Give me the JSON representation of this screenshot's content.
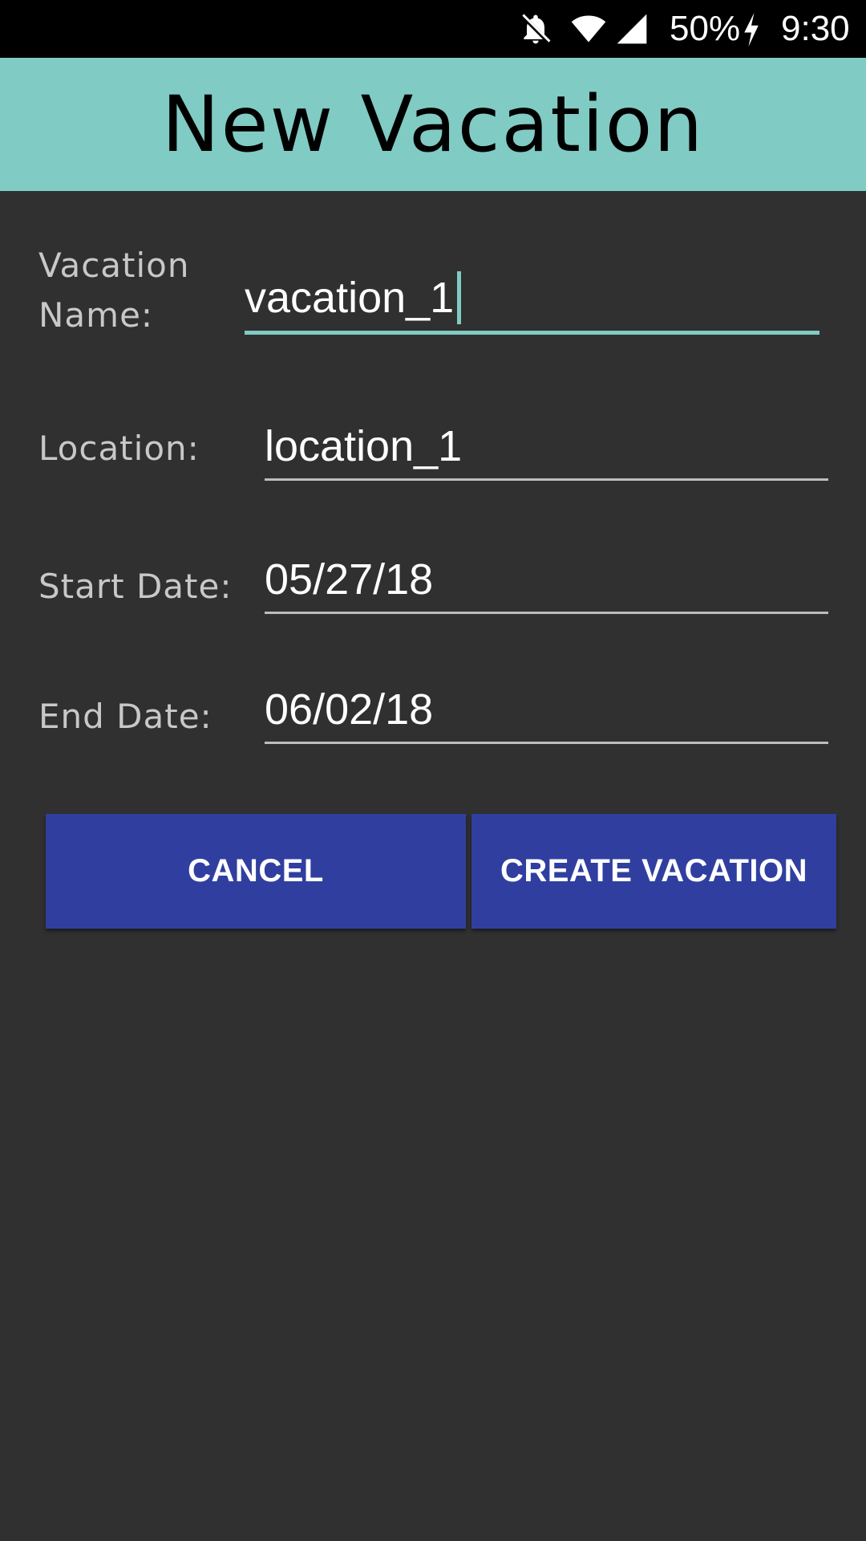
{
  "status_bar": {
    "battery": "50%",
    "time": "9:30",
    "icons": [
      "notifications-off-icon",
      "wifi-icon",
      "cell-signal-icon",
      "charging-bolt-icon"
    ]
  },
  "app_bar": {
    "title": "New Vacation",
    "background_color": "#80cbc4"
  },
  "form": {
    "vacation_name": {
      "label_line1": "Vacation",
      "label_line2": "Name:",
      "value": "vacation_1"
    },
    "location": {
      "label": "Location:",
      "value": "location_1"
    },
    "start_date": {
      "label": "Start Date:",
      "value": "05/27/18"
    },
    "end_date": {
      "label": "End Date:",
      "value": "06/02/18"
    }
  },
  "buttons": {
    "cancel_label": "CANCEL",
    "create_label": "CREATE VACATION",
    "color": "#303f9f"
  },
  "colors": {
    "background": "#303030",
    "accent": "#80cbc4",
    "status_bar": "#000000"
  }
}
